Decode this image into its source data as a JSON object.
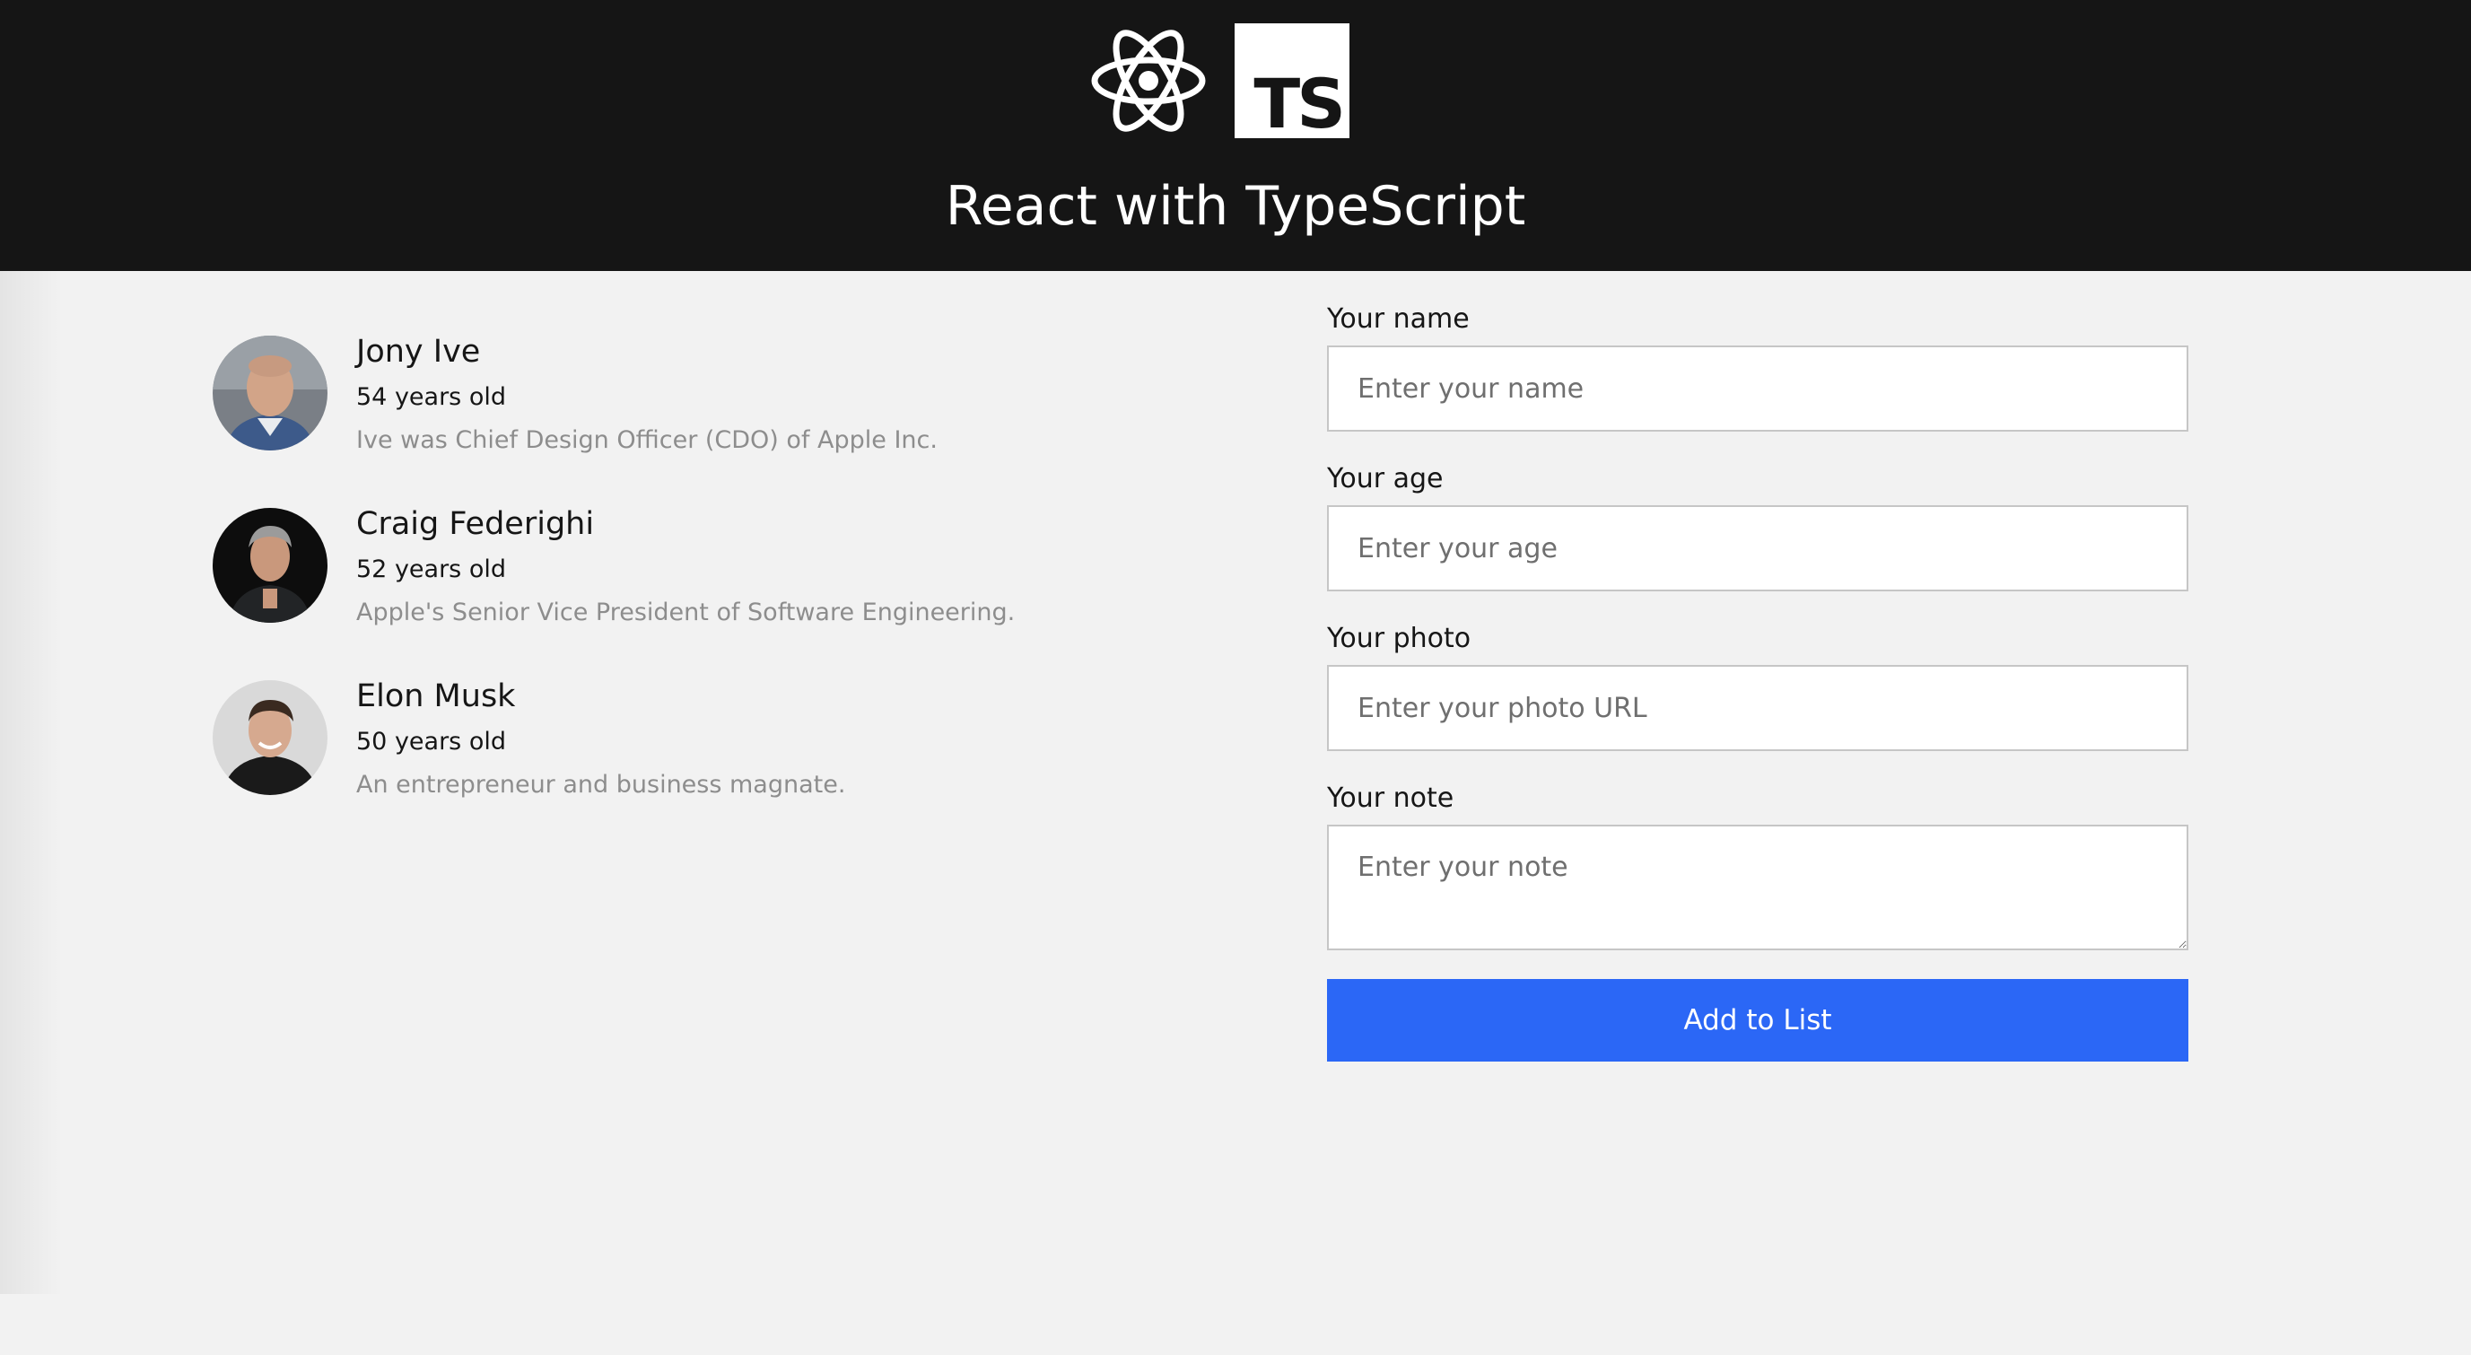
{
  "header": {
    "title": "React with TypeScript",
    "react_logo_icon": "react-atom-icon",
    "ts_logo_text": "TS"
  },
  "people": [
    {
      "name": "Jony Ive",
      "age": "54 years old",
      "note": "Ive was Chief Design Officer (CDO) of Apple Inc."
    },
    {
      "name": "Craig Federighi",
      "age": "52 years old",
      "note": "Apple's Senior Vice President of Software Engineering."
    },
    {
      "name": "Elon Musk",
      "age": "50 years old",
      "note": "An entrepreneur and business magnate."
    }
  ],
  "form": {
    "name_label": "Your name",
    "name_placeholder": "Enter your name",
    "age_label": "Your age",
    "age_placeholder": "Enter your age",
    "photo_label": "Your photo",
    "photo_placeholder": "Enter your photo URL",
    "note_label": "Your note",
    "note_placeholder": "Enter your note",
    "submit_label": "Add to List"
  },
  "colors": {
    "header_bg": "#151515",
    "page_bg": "#f2f2f2",
    "button_bg": "#2b67f6"
  }
}
